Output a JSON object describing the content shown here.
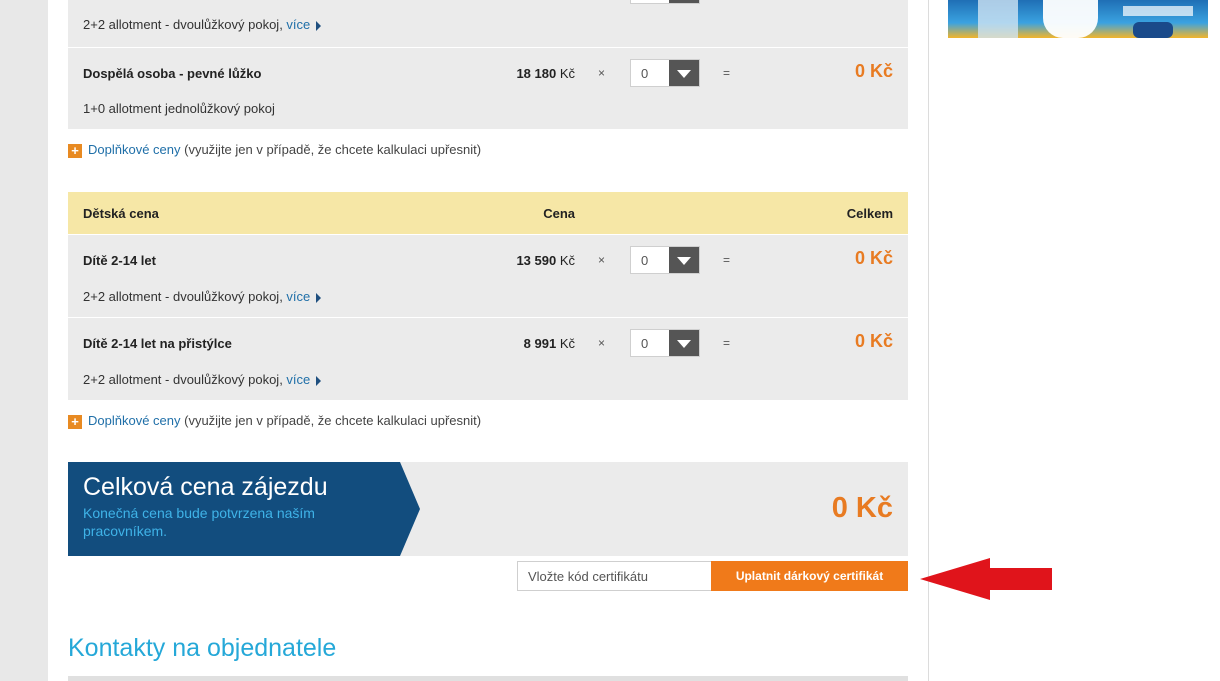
{
  "adult_rows": [
    {
      "name": "",
      "price": "",
      "qty": "",
      "total": "",
      "note": "2+2 allotment - dvoulůžkový pokoj, ",
      "more": "více"
    },
    {
      "name": "Dospělá osoba - pevné lůžko",
      "price_value": "18 180",
      "price_currency": " Kč",
      "times": "×",
      "qty": "0",
      "equals": "=",
      "total": "0 Kč",
      "note": "1+0 allotment jednolůžkový pokoj"
    }
  ],
  "addon": {
    "link": "Doplňkové ceny",
    "text": " (využijte jen v případě, že chcete kalkulaci upřesnit)"
  },
  "child_header": {
    "label": "Dětská cena",
    "price": "Cena",
    "total": "Celkem"
  },
  "child_rows": [
    {
      "name": "Dítě 2-14 let",
      "price_value": "13 590",
      "price_currency": " Kč",
      "times": "×",
      "qty": "0",
      "equals": "=",
      "total": "0 Kč",
      "note": "2+2 allotment - dvoulůžkový pokoj, ",
      "more": "více"
    },
    {
      "name": "Dítě 2-14 let na přistýlce",
      "price_value": "8 991",
      "price_currency": " Kč",
      "times": "×",
      "qty": "0",
      "equals": "=",
      "total": "0 Kč",
      "note": "2+2 allotment - dvoulůžkový pokoj, ",
      "more": "více"
    }
  ],
  "total_box": {
    "title": "Celková cena zájezdu",
    "subtitle": "Konečná cena bude potvrzena naším pracovníkem.",
    "sum": "0 Kč"
  },
  "certificate": {
    "placeholder": "Vložte kód certifikátu",
    "button": "Uplatnit dárkový certifikát"
  },
  "contacts": {
    "title": "Kontakty na objednatele"
  },
  "colors": {
    "accent": "#e87b22",
    "navy": "#124d7e",
    "link": "#1f6fa8",
    "arrow": "#e0141b"
  }
}
